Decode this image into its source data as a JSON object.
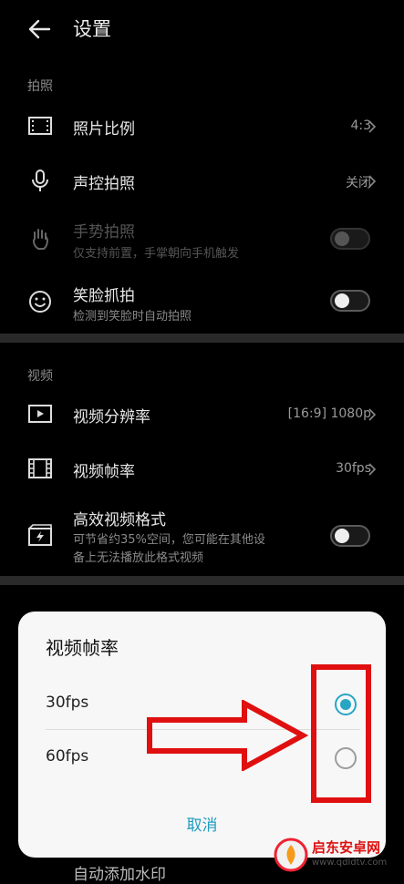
{
  "header": {
    "title": "设置"
  },
  "photo_section": {
    "label": "拍照",
    "aspect": {
      "title": "照片比例",
      "value": "4:3"
    },
    "voice": {
      "title": "声控拍照",
      "value": "关闭"
    },
    "gesture": {
      "title": "手势拍照",
      "subtitle": "仅支持前置，手掌朝向手机触发",
      "enabled": false
    },
    "smile": {
      "title": "笑脸抓拍",
      "subtitle": "检测到笑脸时自动拍照",
      "enabled": true
    }
  },
  "video_section": {
    "label": "视频",
    "resolution": {
      "title": "视频分辨率",
      "value": "[16:9] 1080p"
    },
    "framerate": {
      "title": "视频帧率",
      "value": "30fps"
    },
    "hevc": {
      "title": "高效视频格式",
      "subtitle_line1": "可节省约35%空间，您可能在其他设",
      "subtitle_line2": "备上无法播放此格式视频"
    }
  },
  "dialog": {
    "title": "视频帧率",
    "options": [
      {
        "label": "30fps",
        "selected": true
      },
      {
        "label": "60fps",
        "selected": false
      }
    ],
    "cancel_label": "取消"
  },
  "bottom_peek": {
    "title": "自动添加水印"
  },
  "watermark": {
    "name": "启东安卓网",
    "url": "www.qdldtv.com"
  },
  "colors": {
    "accent": "#27a6c4",
    "annotation": "#e01010"
  }
}
